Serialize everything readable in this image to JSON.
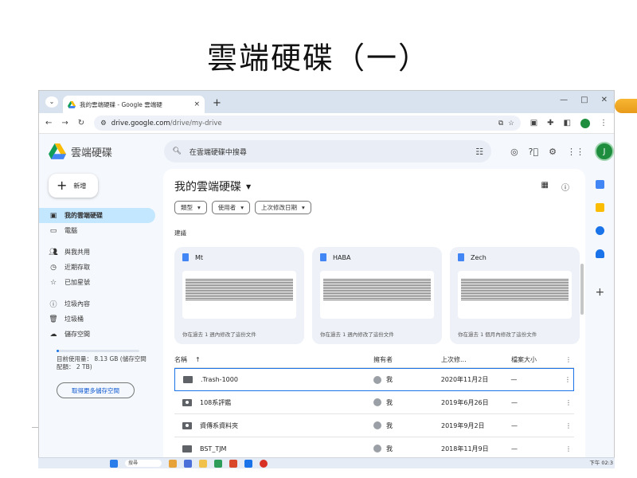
{
  "slide": {
    "title": "雲端硬碟（一）"
  },
  "browser": {
    "tab_title": "我的雲端硬碟 - Google 雲端硬",
    "tab_close": "×",
    "new_tab": "+",
    "url_host": "drive.google.com",
    "url_path": "/drive/my-drive",
    "window_controls": [
      "—",
      "□",
      "✕"
    ]
  },
  "drive": {
    "app_name": "雲端硬碟",
    "search_placeholder": "在雲端硬碟中搜尋",
    "avatar_letter": "J",
    "new_label": "新增",
    "nav": [
      {
        "label": "我的雲端硬碟",
        "icon": "drive-icon",
        "active": true
      },
      {
        "label": "電腦",
        "icon": "computer-icon"
      },
      {
        "label": "與我共用",
        "icon": "shared-icon"
      },
      {
        "label": "近期存取",
        "icon": "clock-icon"
      },
      {
        "label": "已加星號",
        "icon": "star-icon"
      },
      {
        "label": "垃圾內容",
        "icon": "spam-icon"
      },
      {
        "label": "垃圾桶",
        "icon": "trash-icon"
      },
      {
        "label": "儲存空間",
        "icon": "cloud-icon"
      }
    ],
    "storage_text": "目前使用量： 8.13 GB (儲存空間配額： 2 TB)",
    "storage_fraction": 0.004,
    "get_storage_label": "取得更多儲存空間",
    "main_title": "我的雲端硬碟",
    "filters": [
      "類型",
      "使用者",
      "上次修改日期"
    ],
    "suggested_label": "建議",
    "cards": [
      {
        "name": "Mt",
        "note": "你在過去 1 週內修改了這份文件"
      },
      {
        "name": "HABA",
        "note": "你在過去 1 週內修改了這份文件"
      },
      {
        "name": "Zech",
        "note": "你在過去 1 個月內修改了這份文件"
      }
    ],
    "table_headers": {
      "name": "名稱",
      "sort": "↑",
      "owner": "擁有者",
      "modified": "上次修...",
      "size": "檔案大小",
      "more": "⋮"
    },
    "rows": [
      {
        "name": ".Trash-1000",
        "owner": "我",
        "modified": "2020年11月2日",
        "size": "—",
        "shared": false
      },
      {
        "name": "108系評鑑",
        "owner": "我",
        "modified": "2019年6月26日",
        "size": "—",
        "shared": true
      },
      {
        "name": "資傳系資料夾",
        "owner": "我",
        "modified": "2019年9月2日",
        "size": "—",
        "shared": true
      },
      {
        "name": "BST_TJM",
        "owner": "我",
        "modified": "2018年11月9日",
        "size": "—",
        "shared": false
      }
    ]
  },
  "taskbar": {
    "search": "搜尋",
    "time": "下午 02:3"
  },
  "colors": {
    "accent": "#1a73e8",
    "active_nav": "#c2e7ff",
    "titlebar": "#d9e3ef"
  }
}
